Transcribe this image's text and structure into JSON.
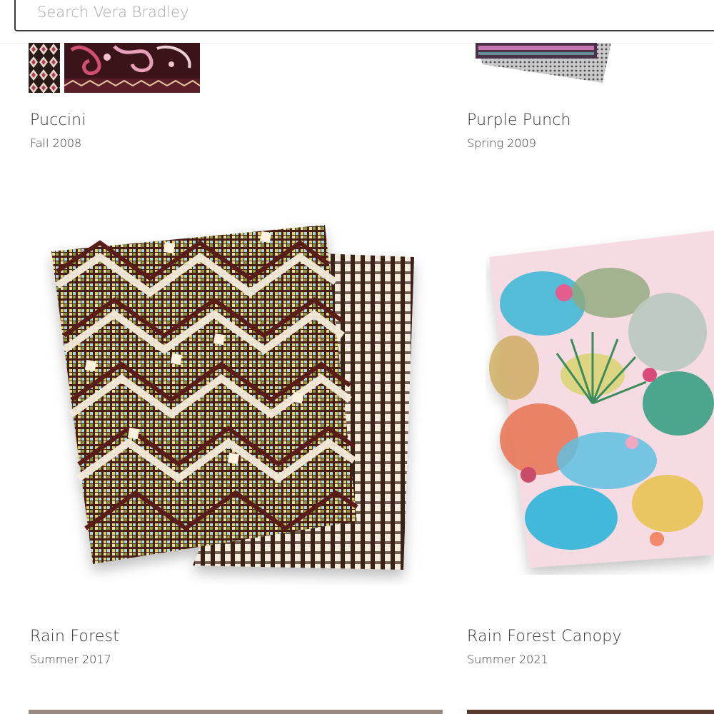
{
  "search": {
    "placeholder": "Search Vera Bradley"
  },
  "patterns": [
    {
      "title": "Puccini",
      "season": "Fall 2008"
    },
    {
      "title": "Purple Punch",
      "season": "Spring 2009"
    },
    {
      "title": "Rain Forest",
      "season": "Summer 2017"
    },
    {
      "title": "Rain Forest Canopy",
      "season": "Summer 2021"
    }
  ],
  "colors": {
    "puccini_primary": "#3a1418",
    "puccini_accent": "#d24f74",
    "rain_forest_brown": "#4a1c14",
    "rain_forest_yellow": "#d8d35a",
    "rain_forest_blue": "#a8d8e0",
    "canopy_pink": "#f6dbe2",
    "canopy_teal": "#37b6d6"
  }
}
